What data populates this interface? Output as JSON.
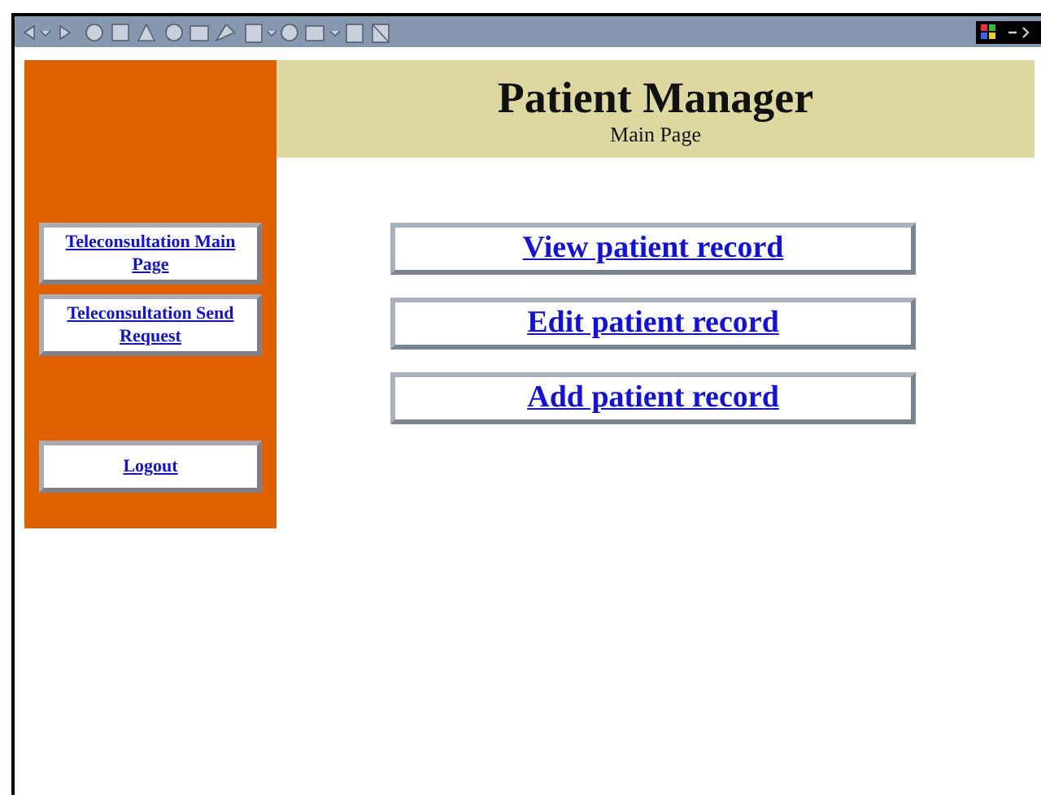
{
  "header": {
    "title": "Patient Manager",
    "subtitle": "Main Page"
  },
  "sidebar": {
    "groups": [
      [
        "Teleconsultation Main Page",
        "Teleconsultation Send Request"
      ],
      [
        "Logout"
      ]
    ]
  },
  "actions": [
    "View patient record",
    "Edit patient record",
    "Add patient record"
  ]
}
